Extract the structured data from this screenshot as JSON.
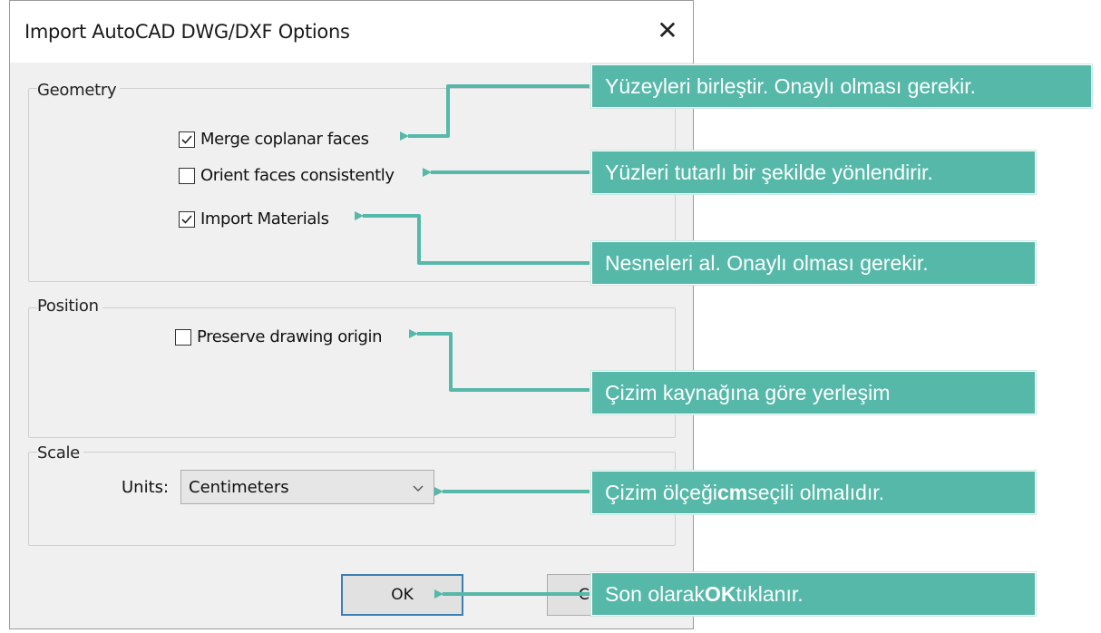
{
  "dialog": {
    "title": "Import AutoCAD DWG/DXF Options",
    "close_glyph": "✕"
  },
  "geometry": {
    "label": "Geometry",
    "options": [
      {
        "label": "Merge coplanar faces",
        "checked": true
      },
      {
        "label": "Orient faces consistently",
        "checked": false
      },
      {
        "label": "Import Materials",
        "checked": true
      }
    ]
  },
  "position": {
    "label": "Position",
    "options": [
      {
        "label": "Preserve drawing origin",
        "checked": false
      }
    ]
  },
  "scale": {
    "label": "Scale",
    "units_label": "Units:",
    "units_value": "Centimeters"
  },
  "buttons": {
    "ok": "OK",
    "cancel_partial": "C"
  },
  "callouts": {
    "merge": "Yüzeyleri birleştir. Onaylı olması gerekir.",
    "orient": "Yüzleri tutarlı bir şekilde yönlendirir.",
    "materials": "Nesneleri al. Onaylı olması gerekir.",
    "origin": "Çizim kaynağına göre yerleşim",
    "scale_pre": "Çizim ölçeği ",
    "scale_bold": "cm",
    "scale_post": " seçili olmalıdır.",
    "ok_pre": "Son olarak ",
    "ok_bold": "OK",
    "ok_post": " tıklanır."
  },
  "colors": {
    "callout_bg": "#55b8a8",
    "ok_border": "#3c7fb1"
  }
}
